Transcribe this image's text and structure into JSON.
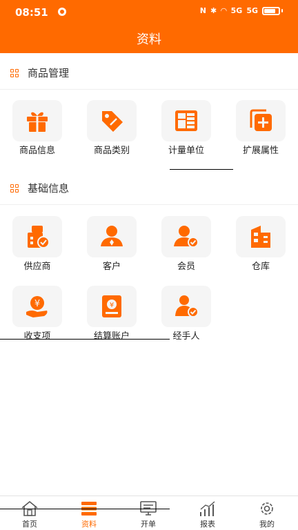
{
  "status_bar": {
    "time": "08:51",
    "signal_1": "5G",
    "signal_2": "5G"
  },
  "header": {
    "title": "资料"
  },
  "sections": {
    "goods": {
      "title": "商品管理",
      "items": [
        {
          "label": "商品信息",
          "icon": "gift-icon"
        },
        {
          "label": "商品类别",
          "icon": "tag-icon"
        },
        {
          "label": "计量单位",
          "icon": "ruler-grid-icon"
        },
        {
          "label": "扩展属性",
          "icon": "add-copy-icon"
        }
      ]
    },
    "basic": {
      "title": "基础信息",
      "items": [
        {
          "label": "供应商",
          "icon": "supplier-icon"
        },
        {
          "label": "客户",
          "icon": "customer-icon"
        },
        {
          "label": "会员",
          "icon": "member-icon"
        },
        {
          "label": "仓库",
          "icon": "warehouse-icon"
        },
        {
          "label": "收支项",
          "icon": "money-hand-icon"
        },
        {
          "label": "结算账户",
          "icon": "account-book-icon"
        },
        {
          "label": "经手人",
          "icon": "handler-icon"
        }
      ]
    }
  },
  "tabs": [
    {
      "label": "首页",
      "icon": "home-icon",
      "active": false
    },
    {
      "label": "资料",
      "icon": "data-icon",
      "active": true
    },
    {
      "label": "开单",
      "icon": "billing-icon",
      "active": false
    },
    {
      "label": "报表",
      "icon": "report-icon",
      "active": false
    },
    {
      "label": "我的",
      "icon": "settings-icon",
      "active": false
    }
  ],
  "colors": {
    "accent": "#ff6a00",
    "tile_bg": "#f5f5f5",
    "text": "#222222"
  }
}
